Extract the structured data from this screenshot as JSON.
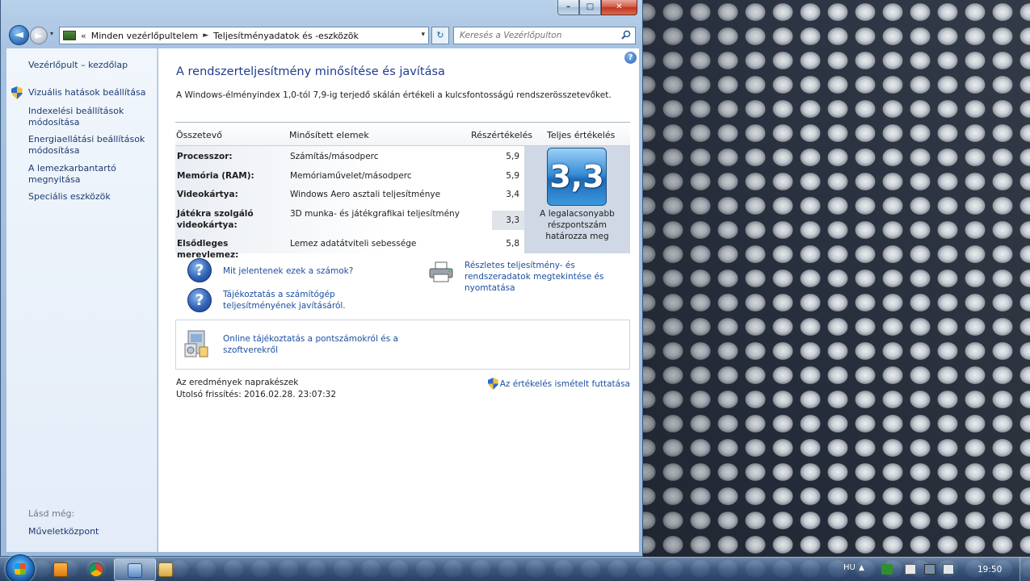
{
  "window": {
    "caption": {
      "minimize": "–",
      "maximize": "□",
      "close": "✕"
    }
  },
  "navbar": {
    "back_glyph": "◄",
    "fwd_glyph": "►",
    "dropdown_glyph": "▾",
    "breadcrumb_overflow": "«",
    "breadcrumbs": [
      "Minden vezérlőpultelem",
      "Teljesítményadatok és -eszközök"
    ],
    "breadcrumb_separator": "►",
    "address_dropdown": "▾",
    "refresh_glyph": "↻",
    "search_placeholder": "Keresés a Vezérlőpulton"
  },
  "leftpane": {
    "home_link": "Vezérlőpult – kezdőlap",
    "links": [
      {
        "label": "Vizuális hatások beállítása",
        "shield": true
      },
      {
        "label": "Indexelési beállítások módosítása",
        "shield": false
      },
      {
        "label": "Energiaellátási beállítások módosítása",
        "shield": false
      },
      {
        "label": "A lemezkarbantartó megnyitása",
        "shield": false
      },
      {
        "label": "Speciális eszközök",
        "shield": false
      }
    ],
    "see_also_label": "Lásd még:",
    "see_also_links": [
      "Műveletközpont"
    ]
  },
  "content": {
    "help_glyph": "?",
    "title": "A rendszerteljesítmény minősítése és javítása",
    "description": "A Windows-élményindex 1,0-tól 7,9-ig terjedő skálán értékeli a kulcsfontosságú rendszerösszetevőket.",
    "table": {
      "headers": [
        "Összetevő",
        "Minősített elemek",
        "Részértékelés",
        "Teljes értékelés"
      ],
      "rows": [
        {
          "component": "Processzor:",
          "rated": "Számítás/másodperc",
          "subscore": "5,9"
        },
        {
          "component": "Memória (RAM):",
          "rated": "Memóriaművelet/másodperc",
          "subscore": "5,9"
        },
        {
          "component": "Videokártya:",
          "rated": "Windows Aero asztali teljesítménye",
          "subscore": "3,4"
        },
        {
          "component": "Játékra szolgáló videokártya:",
          "rated": "3D munka- és játékgrafikai teljesítmény",
          "subscore": "3,3"
        },
        {
          "component": "Elsődleges merevlemez:",
          "rated": "Lemez adatátviteli sebessége",
          "subscore": "5,8"
        }
      ],
      "base_score": "3,3",
      "base_score_caption": "A legalacsonyabb részpontszám határozza meg"
    },
    "help_links": [
      "Mit jelentenek ezek a számok?",
      "Tájékoztatás a számítógép teljesítményének javításáról."
    ],
    "question_glyph": "?",
    "print_link": "Részletes teljesítmény- és rendszeradatok megtekintése és nyomtatása",
    "online_link": "Online tájékoztatás a pontszámokról és a szoftverekről",
    "status": "Az eredmények naprakészek",
    "last_update": "Utolsó frissítés: 2016.02.28. 23:07:32",
    "rerun_link": "Az értékelés ismételt futtatása"
  },
  "taskbar": {
    "language": "HU",
    "tray_arrow": "▲",
    "clock": "19:50"
  },
  "colors": {
    "link": "#1c4fa0",
    "title": "#1e3d8f",
    "score_tile": "#3a8fd6"
  }
}
